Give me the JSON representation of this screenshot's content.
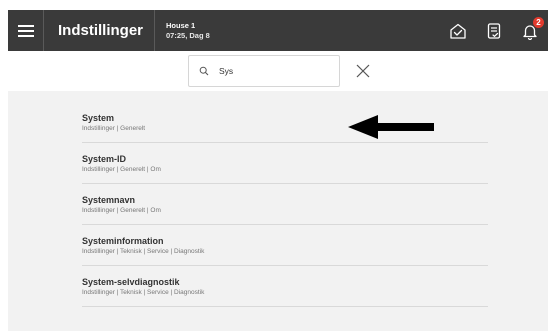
{
  "header": {
    "title": "Indstillinger",
    "house_name": "House 1",
    "house_time": "07:25, Dag 8",
    "notification_count": "2",
    "icons": [
      "menu-icon",
      "home-icon",
      "report-icon",
      "bell-icon"
    ]
  },
  "search": {
    "value": "Sys",
    "placeholder": ""
  },
  "results": [
    {
      "title": "System",
      "path": "Indstillinger | Generelt"
    },
    {
      "title": "System-ID",
      "path": "Indstillinger | Generelt | Om"
    },
    {
      "title": "Systemnavn",
      "path": "Indstillinger | Generelt | Om"
    },
    {
      "title": "Systeminformation",
      "path": "Indstillinger | Teknisk | Service | Diagnostik"
    },
    {
      "title": "System-selvdiagnostik",
      "path": "Indstillinger | Teknisk | Service | Diagnostik"
    }
  ],
  "colors": {
    "topbar": "#3a3a3a",
    "panel": "#f2f2f2",
    "badge": "#e23b2e"
  }
}
